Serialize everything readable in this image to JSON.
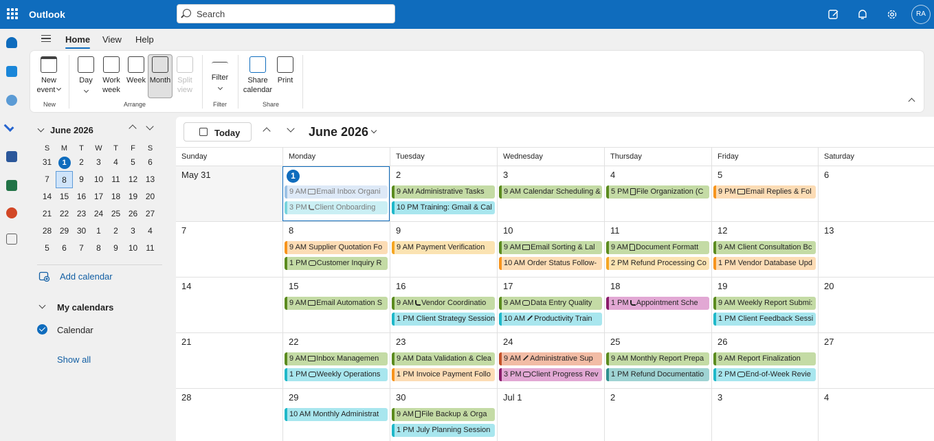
{
  "app": {
    "name": "Outlook",
    "search_placeholder": "Search",
    "avatar_initials": "RA"
  },
  "ribbon": {
    "tabs": [
      "Home",
      "View",
      "Help"
    ],
    "buttons": {
      "new_event": [
        "New",
        "event"
      ],
      "day": "Day",
      "work_week": [
        "Work",
        "week"
      ],
      "week": "Week",
      "month": "Month",
      "split_view": [
        "Split",
        "view"
      ],
      "filter": "Filter",
      "share_calendar": [
        "Share",
        "calendar"
      ],
      "print": "Print"
    },
    "groups": [
      "New",
      "Arrange",
      "Filter",
      "Share"
    ]
  },
  "mini_calendar": {
    "title": "June 2026",
    "dow": [
      "S",
      "M",
      "T",
      "W",
      "T",
      "F",
      "S"
    ],
    "weeks": [
      [
        "31",
        "1",
        "2",
        "3",
        "4",
        "5",
        "6"
      ],
      [
        "7",
        "8",
        "9",
        "10",
        "11",
        "12",
        "13"
      ],
      [
        "14",
        "15",
        "16",
        "17",
        "18",
        "19",
        "20"
      ],
      [
        "21",
        "22",
        "23",
        "24",
        "25",
        "26",
        "27"
      ],
      [
        "28",
        "29",
        "30",
        "1",
        "2",
        "3",
        "4"
      ],
      [
        "5",
        "6",
        "7",
        "8",
        "9",
        "10",
        "11"
      ]
    ],
    "today": "1",
    "selected": "8"
  },
  "left_pane": {
    "add_calendar": "Add calendar",
    "my_calendars": "My calendars",
    "calendar_name": "Calendar",
    "show_all": "Show all"
  },
  "main": {
    "today_button": "Today",
    "month_title": "June 2026",
    "dow": [
      "Sunday",
      "Monday",
      "Tuesday",
      "Wednesday",
      "Thursday",
      "Friday",
      "Saturday"
    ],
    "weeks": [
      [
        "May 31",
        "1",
        "2",
        "3",
        "4",
        "5",
        "6"
      ],
      [
        "7",
        "8",
        "9",
        "10",
        "11",
        "12",
        "13"
      ],
      [
        "14",
        "15",
        "16",
        "17",
        "18",
        "19",
        "20"
      ],
      [
        "21",
        "22",
        "23",
        "24",
        "25",
        "26",
        "27"
      ],
      [
        "28",
        "29",
        "30",
        "Jul 1",
        "2",
        "3",
        "4"
      ]
    ]
  },
  "colors": {
    "green": "#c4dba5",
    "green_bar": "#5b8b1f",
    "cyan": "#a8e6ee",
    "cyan_bar": "#1fb8c9",
    "orange": "#fcdcb5",
    "orange_bar": "#f7941d",
    "yellow": "#fbe3b2",
    "yellow_bar": "#f5a623",
    "pink": "#e2a8d4",
    "pink_bar": "#8b1c6b",
    "salmon": "#f2bca5",
    "salmon_bar": "#c4532b",
    "teal": "#9fd3d3",
    "teal_bar": "#2f8f8f",
    "blue": "#c7dcf2",
    "blue_bar": "#5b9bd5"
  },
  "events": [
    {
      "w": 0,
      "d": 1,
      "slot": 0,
      "time": "9 AM",
      "title": "Email Inbox Organi",
      "icon": "mail-icon",
      "color": "blue",
      "past": true
    },
    {
      "w": 0,
      "d": 1,
      "slot": 1,
      "time": "3 PM",
      "title": "Client Onboarding",
      "icon": "phone-icon",
      "color": "cyan",
      "past": true
    },
    {
      "w": 0,
      "d": 2,
      "slot": 0,
      "time": "9 AM",
      "title": "Administrative Tasks",
      "icon": "",
      "color": "green"
    },
    {
      "w": 0,
      "d": 2,
      "slot": 1,
      "time": "10 PM",
      "title": "Training: Gmail & Cal",
      "icon": "",
      "color": "cyan"
    },
    {
      "w": 0,
      "d": 3,
      "slot": 0,
      "time": "9 AM",
      "title": "Calendar Scheduling &",
      "icon": "",
      "color": "green"
    },
    {
      "w": 0,
      "d": 4,
      "slot": 0,
      "time": "5 PM",
      "title": "File Organization (C",
      "icon": "doc-icon",
      "color": "green"
    },
    {
      "w": 0,
      "d": 5,
      "slot": 0,
      "time": "9 PM",
      "title": "Email Replies & Fol",
      "icon": "mail-icon",
      "color": "orange"
    },
    {
      "w": 1,
      "d": 1,
      "slot": 0,
      "time": "9 AM",
      "title": "Supplier Quotation Fo",
      "icon": "",
      "color": "orange"
    },
    {
      "w": 1,
      "d": 1,
      "slot": 1,
      "time": "1 PM",
      "title": "Customer Inquiry R",
      "icon": "chat-icon",
      "color": "green"
    },
    {
      "w": 1,
      "d": 2,
      "slot": 0,
      "time": "9 AM",
      "title": "Payment Verification",
      "icon": "",
      "color": "yellow"
    },
    {
      "w": 1,
      "d": 3,
      "slot": 0,
      "time": "9 AM",
      "title": "Email Sorting & Lal",
      "icon": "mail-icon",
      "color": "green"
    },
    {
      "w": 1,
      "d": 3,
      "slot": 1,
      "time": "10 AM",
      "title": "Order Status Follow-",
      "icon": "",
      "color": "orange"
    },
    {
      "w": 1,
      "d": 4,
      "slot": 0,
      "time": "9 AM",
      "title": "Document Formatt",
      "icon": "page-icon",
      "color": "green"
    },
    {
      "w": 1,
      "d": 4,
      "slot": 1,
      "time": "2 PM",
      "title": "Refund Processing Co",
      "icon": "",
      "color": "yellow"
    },
    {
      "w": 1,
      "d": 5,
      "slot": 0,
      "time": "9 AM",
      "title": "Client Consultation Bc",
      "icon": "",
      "color": "green"
    },
    {
      "w": 1,
      "d": 5,
      "slot": 1,
      "time": "1 PM",
      "title": "Vendor Database Upd",
      "icon": "",
      "color": "orange"
    },
    {
      "w": 2,
      "d": 1,
      "slot": 0,
      "time": "9 AM",
      "title": "Email Automation S",
      "icon": "mail-icon",
      "color": "green"
    },
    {
      "w": 2,
      "d": 2,
      "slot": 0,
      "time": "9 AM",
      "title": "Vendor Coordinatio",
      "icon": "phone-icon",
      "color": "green"
    },
    {
      "w": 2,
      "d": 2,
      "slot": 1,
      "time": "1 PM",
      "title": "Client Strategy Session",
      "icon": "",
      "color": "cyan"
    },
    {
      "w": 2,
      "d": 3,
      "slot": 0,
      "time": "9 AM",
      "title": "Data Entry Quality",
      "icon": "chat-icon",
      "color": "green"
    },
    {
      "w": 2,
      "d": 3,
      "slot": 1,
      "time": "10 AM",
      "title": "Productivity Train",
      "icon": "pen-icon",
      "color": "cyan"
    },
    {
      "w": 2,
      "d": 4,
      "slot": 0,
      "time": "1 PM",
      "title": "Appointment Sche",
      "icon": "phone-icon",
      "color": "pink"
    },
    {
      "w": 2,
      "d": 5,
      "slot": 0,
      "time": "9 AM",
      "title": "Weekly Report Submi:",
      "icon": "",
      "color": "green"
    },
    {
      "w": 2,
      "d": 5,
      "slot": 1,
      "time": "1 PM",
      "title": "Client Feedback Sessi",
      "icon": "",
      "color": "cyan"
    },
    {
      "w": 3,
      "d": 1,
      "slot": 0,
      "time": "9 AM",
      "title": "Inbox Managemen",
      "icon": "mail-icon",
      "color": "green"
    },
    {
      "w": 3,
      "d": 1,
      "slot": 1,
      "time": "1 PM",
      "title": "Weekly Operations",
      "icon": "chat-icon",
      "color": "cyan"
    },
    {
      "w": 3,
      "d": 2,
      "slot": 0,
      "time": "9 AM",
      "title": "Data Validation & Clea",
      "icon": "",
      "color": "green"
    },
    {
      "w": 3,
      "d": 2,
      "slot": 1,
      "time": "1 PM",
      "title": "Invoice Payment Follo",
      "icon": "",
      "color": "orange"
    },
    {
      "w": 3,
      "d": 3,
      "slot": 0,
      "time": "9 AM",
      "title": "Administrative Sup",
      "icon": "pen-icon",
      "color": "salmon"
    },
    {
      "w": 3,
      "d": 3,
      "slot": 1,
      "time": "3 PM",
      "title": "Client Progress Rev",
      "icon": "chat-icon",
      "color": "pink"
    },
    {
      "w": 3,
      "d": 4,
      "slot": 0,
      "time": "9 AM",
      "title": "Monthly Report Prepa",
      "icon": "",
      "color": "green"
    },
    {
      "w": 3,
      "d": 4,
      "slot": 1,
      "time": "1 PM",
      "title": "Refund Documentatio",
      "icon": "",
      "color": "teal"
    },
    {
      "w": 3,
      "d": 5,
      "slot": 0,
      "time": "9 AM",
      "title": "Report Finalization",
      "icon": "",
      "color": "green"
    },
    {
      "w": 3,
      "d": 5,
      "slot": 1,
      "time": "2 PM",
      "title": "End-of-Week Revie",
      "icon": "chat-icon",
      "color": "cyan"
    },
    {
      "w": 4,
      "d": 1,
      "slot": 0,
      "time": "10 AM",
      "title": "Monthly Administrat",
      "icon": "",
      "color": "cyan"
    },
    {
      "w": 4,
      "d": 2,
      "slot": 0,
      "time": "9 AM",
      "title": "File Backup & Orga",
      "icon": "doc-icon",
      "color": "green"
    },
    {
      "w": 4,
      "d": 2,
      "slot": 1,
      "time": "1 PM",
      "title": "July Planning Session",
      "icon": "",
      "color": "cyan"
    }
  ]
}
